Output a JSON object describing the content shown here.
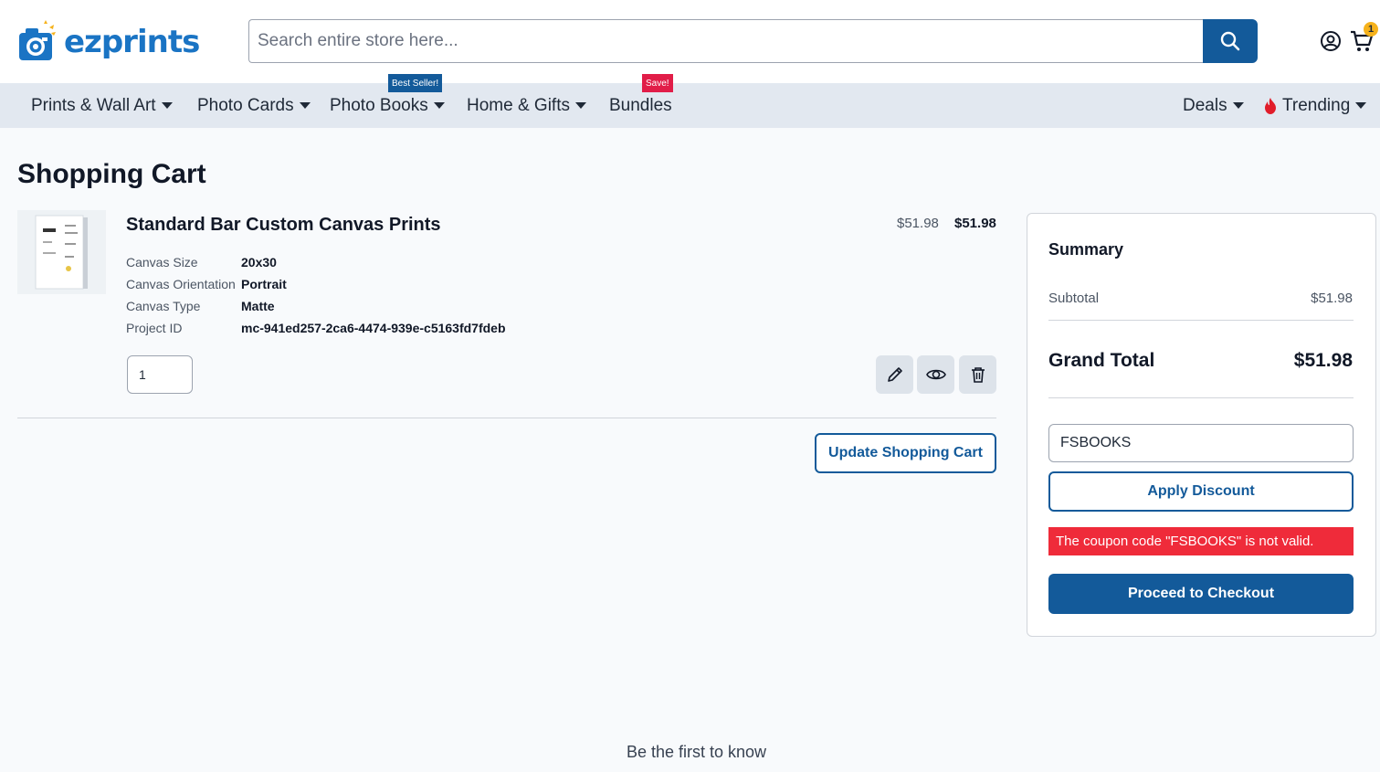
{
  "brand": {
    "name": "ezprints",
    "color": "#1a74c4",
    "accent": "#135a9a"
  },
  "search": {
    "placeholder": "Search entire store here..."
  },
  "header": {
    "cart_count": "1"
  },
  "nav": {
    "items": [
      {
        "label": "Prints & Wall Art"
      },
      {
        "label": "Photo Cards"
      },
      {
        "label": "Photo Books",
        "badge": "Best Seller!"
      },
      {
        "label": "Home & Gifts"
      },
      {
        "label": "Bundles",
        "badge": "Save!"
      },
      {
        "label": "Deals"
      },
      {
        "label": "Trending"
      }
    ]
  },
  "page": {
    "title": "Shopping Cart"
  },
  "cart_item": {
    "name": "Standard Bar Custom Canvas Prints",
    "original_price": "$51.98",
    "price": "$51.98",
    "options": [
      {
        "label": "Canvas Size",
        "value": "20x30"
      },
      {
        "label": "Canvas Orientation",
        "value": "Portrait"
      },
      {
        "label": "Canvas Type",
        "value": "Matte"
      },
      {
        "label": "Project ID",
        "value": "mc-941ed257-2ca6-4474-939e-c5163fd7fdeb"
      }
    ],
    "quantity": "1",
    "actions": [
      "edit-icon",
      "view-icon",
      "delete-icon"
    ]
  },
  "cart_actions": {
    "update_label": "Update Shopping Cart"
  },
  "summary": {
    "title": "Summary",
    "subtotal_label": "Subtotal",
    "subtotal_value": "$51.98",
    "grand_total_label": "Grand Total",
    "grand_total_value": "$51.98",
    "coupon_value": "FSBOOKS",
    "apply_label": "Apply Discount",
    "error_message": "The coupon code \"FSBOOKS\" is not valid.",
    "error_color": "#ef2b3a",
    "checkout_label": "Proceed to Checkout"
  },
  "footer": {
    "newsletter_heading": "Be the first to know"
  }
}
